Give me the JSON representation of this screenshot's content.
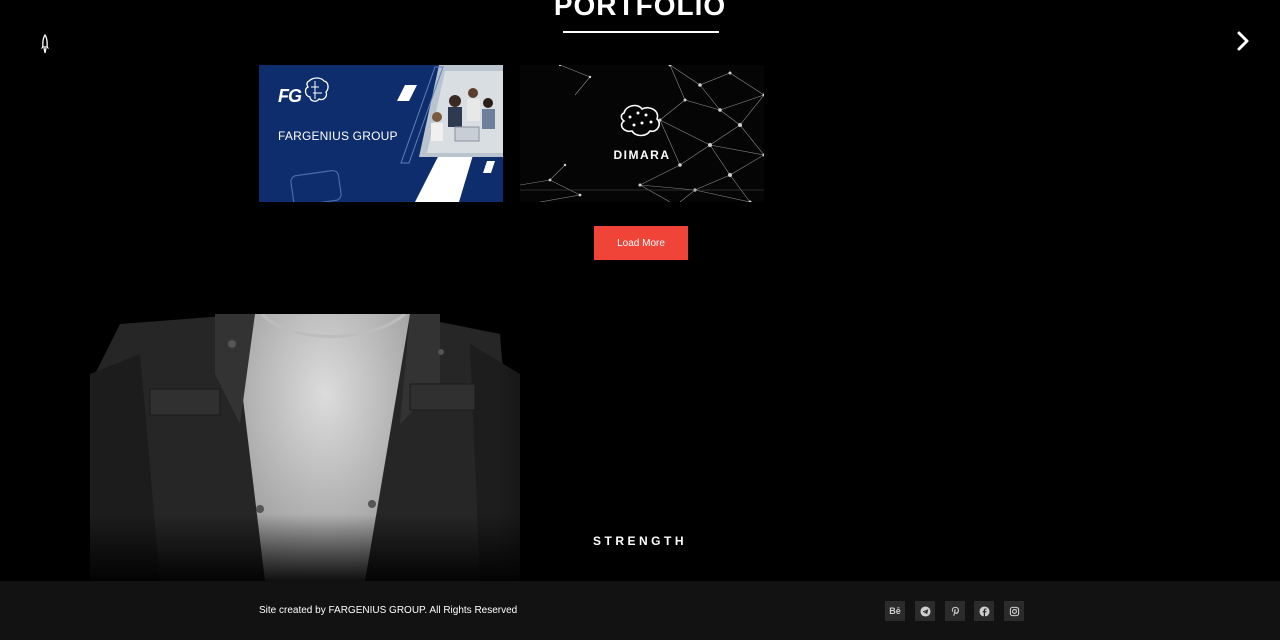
{
  "portfolio": {
    "title": "PORTFOLIO",
    "cards": [
      {
        "name": "FARGENIUS GROUP",
        "logo": "FG"
      },
      {
        "name": "DIMARA",
        "footer_mark": "DIMARA"
      }
    ],
    "load_more_label": "Load More"
  },
  "hero": {
    "caption": "STRENGTH"
  },
  "footer": {
    "copyright": "Site created by FARGENIUS GROUP. All Rights Reserved",
    "social": [
      {
        "label": "Bē",
        "icon": "behance-icon"
      },
      {
        "label": "",
        "icon": "telegram-icon"
      },
      {
        "label": "",
        "icon": "pinterest-icon"
      },
      {
        "label": "",
        "icon": "facebook-icon"
      },
      {
        "label": "",
        "icon": "instagram-icon"
      }
    ]
  },
  "colors": {
    "accent": "#f04438",
    "fg_card_blue": "#0e2d6c",
    "footer_bg": "#121212"
  }
}
